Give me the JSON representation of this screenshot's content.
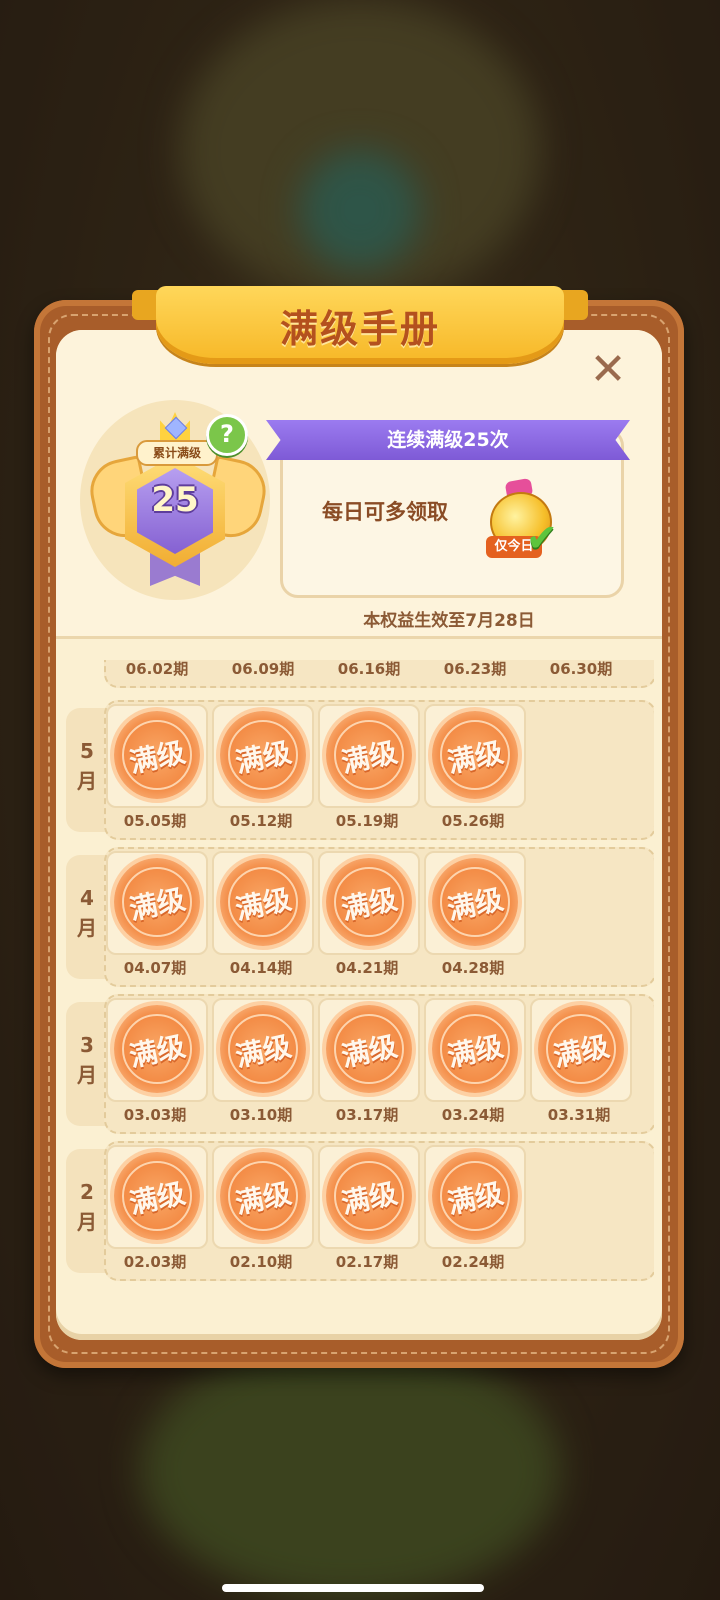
{
  "header": {
    "title": "满级手册",
    "close_symbol": "✕"
  },
  "badge": {
    "label": "累计满级",
    "count": "25",
    "help_symbol": "?"
  },
  "reward": {
    "banner": "连续满级25次",
    "description": "每日可多领取",
    "tag": "仅今日",
    "check_symbol": "✔",
    "validity": "本权益生效至7月28日"
  },
  "stamp_text": "满级",
  "june": {
    "dates": [
      "06.02期",
      "06.09期",
      "06.16期",
      "06.23期",
      "06.30期"
    ]
  },
  "months": [
    {
      "label": "5\n月",
      "dates": [
        "05.05期",
        "05.12期",
        "05.19期",
        "05.26期"
      ]
    },
    {
      "label": "4\n月",
      "dates": [
        "04.07期",
        "04.14期",
        "04.21期",
        "04.28期"
      ]
    },
    {
      "label": "3\n月",
      "dates": [
        "03.03期",
        "03.10期",
        "03.17期",
        "03.24期",
        "03.31期"
      ]
    },
    {
      "label": "2\n月",
      "dates": [
        "02.03期",
        "02.10期",
        "02.17期",
        "02.24期"
      ]
    }
  ],
  "colors": {
    "stamp": "#f38b45",
    "banner": "#8a66e0",
    "accent": "#b4511e"
  }
}
